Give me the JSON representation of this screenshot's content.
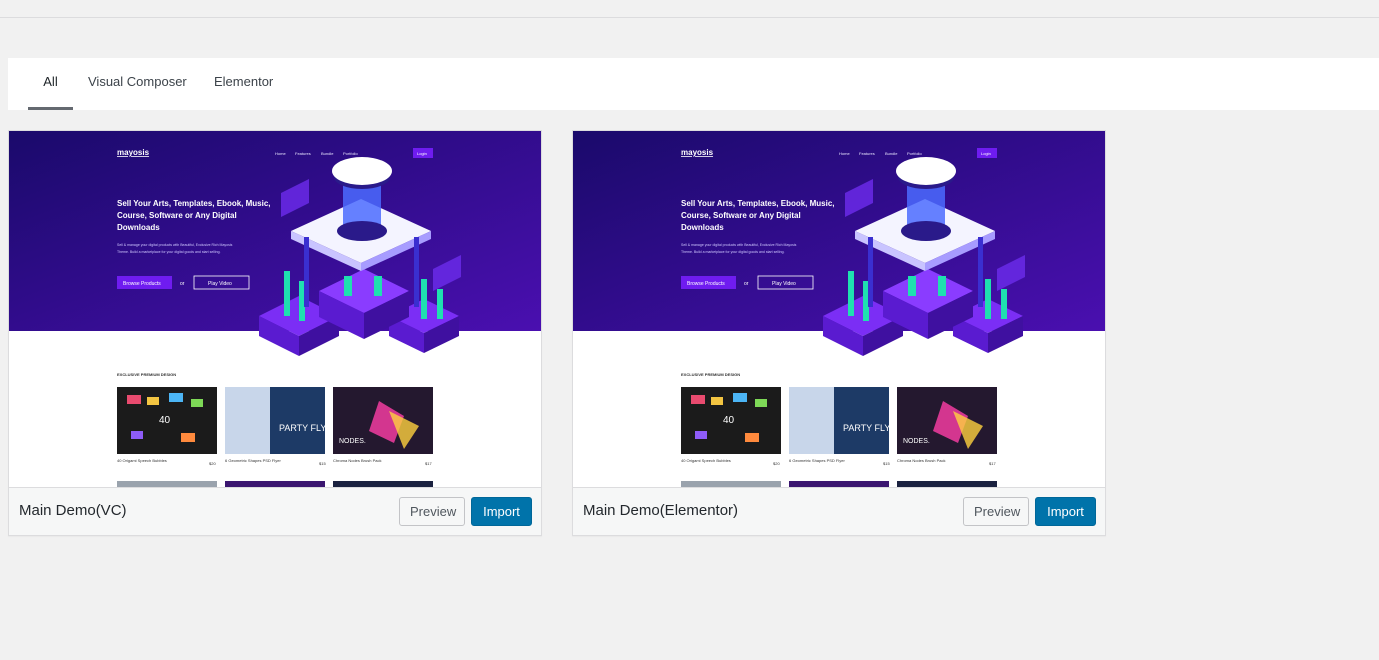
{
  "tabs": [
    {
      "label": "All",
      "active": true
    },
    {
      "label": "Visual Composer",
      "active": false
    },
    {
      "label": "Elementor",
      "active": false
    }
  ],
  "demos": [
    {
      "title": "Main Demo(VC)",
      "preview_label": "Preview",
      "import_label": "Import"
    },
    {
      "title": "Main Demo(Elementor)",
      "preview_label": "Preview",
      "import_label": "Import"
    }
  ],
  "thumbnail": {
    "logo": "mayosis",
    "nav": [
      "Home",
      "Features",
      "Bundle",
      "Portfolio",
      "Login"
    ],
    "headline": [
      "Sell Your Arts, Templates, Ebook, Music,",
      "Course, Software or Any Digital",
      "Downloads"
    ],
    "subtext": [
      "Sell & manage your digital products with Beautiful, Exclusive Rich Mayosis",
      "Theme. Build a marketplace for your digital goods and start selling."
    ],
    "primary_cta": "Browse Products",
    "or_text": "or",
    "secondary_cta": "Play Video",
    "section_label": "EXCLUSIVE PREMIUM DESIGN",
    "products": [
      {
        "name": "40 Origami Speech Bubbles",
        "price": "$20",
        "card_text": "40"
      },
      {
        "name": "6 Geometric Shapes PSD Flyer",
        "price": "$15",
        "card_text": "PARTY FLYER"
      },
      {
        "name": "Chroma Nodes Brush Pack",
        "price": "$17",
        "card_text": "NODES."
      }
    ]
  },
  "colors": {
    "hero_start": "#1a0a6b",
    "hero_end": "#4a0fb0",
    "button_purple": "#6f1cf0",
    "import_blue": "#0073aa"
  }
}
